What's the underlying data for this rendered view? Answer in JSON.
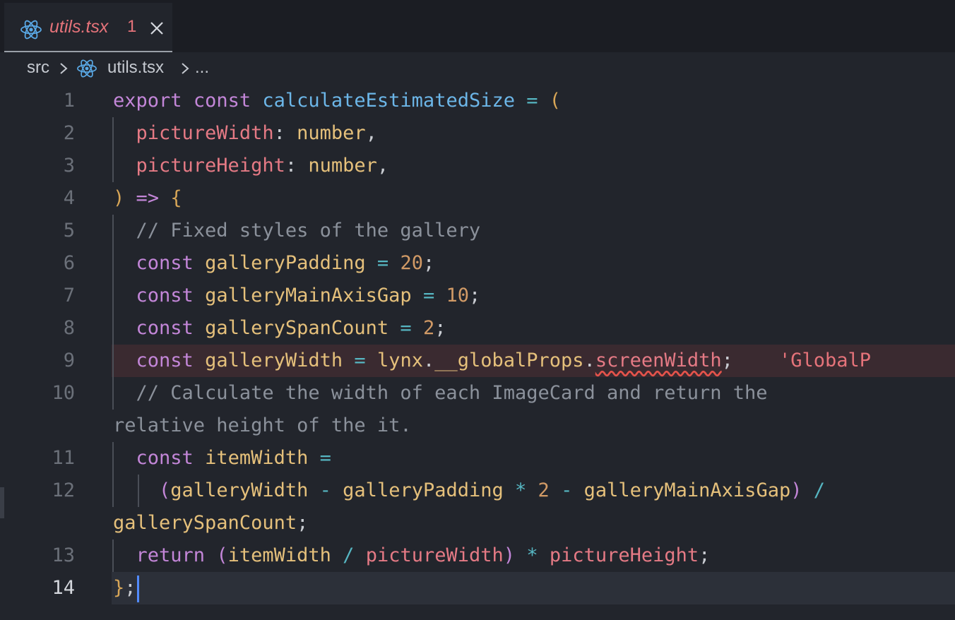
{
  "tab": {
    "title": "utils.tsx",
    "problem_count": "1",
    "icon": "react-icon",
    "close_icon": "close-icon"
  },
  "breadcrumb": {
    "folder": "src",
    "file": "utils.tsx",
    "more": "..."
  },
  "lines": {
    "n1": "1",
    "n2": "2",
    "n3": "3",
    "n4": "4",
    "n5": "5",
    "n6": "6",
    "n7": "7",
    "n8": "8",
    "n9": "9",
    "n10": "10",
    "n11": "11",
    "n12": "12",
    "n13": "13",
    "n14": "14"
  },
  "code": {
    "l1_export": "export",
    "l1_const": "const",
    "l1_fn": "calculateEstimatedSize",
    "l1_eq": "=",
    "l1_paren": "(",
    "l2_param": "pictureWidth",
    "l2_colon": ":",
    "l2_type": "number",
    "l2_comma": ",",
    "l3_param": "pictureHeight",
    "l3_colon": ":",
    "l3_type": "number",
    "l3_comma": ",",
    "l4_paren": ")",
    "l4_arrow": "=>",
    "l4_brace": "{",
    "l5_comment": "// Fixed styles of the gallery",
    "l6_const": "const",
    "l6_var": "galleryPadding",
    "l6_eq": "=",
    "l6_num": "20",
    "l6_semi": ";",
    "l7_const": "const",
    "l7_var": "galleryMainAxisGap",
    "l7_eq": "=",
    "l7_num": "10",
    "l7_semi": ";",
    "l8_const": "const",
    "l8_var": "gallerySpanCount",
    "l8_eq": "=",
    "l8_num": "2",
    "l8_semi": ";",
    "l9_const": "const",
    "l9_var": "galleryWidth",
    "l9_eq": "=",
    "l9_obj": "lynx",
    "l9_dot1": ".",
    "l9_prop1": "__globalProps",
    "l9_dot2": ".",
    "l9_prop2": "screenWidth",
    "l9_semi": ";",
    "l9_error": "'GlobalP",
    "l10_comment": "// Calculate the width of each ImageCard and return the",
    "l10_cont": "relative height of the it.",
    "l11_const": "const",
    "l11_var": "itemWidth",
    "l11_eq": "=",
    "l12_open": "(",
    "l12_a": "galleryWidth",
    "l12_minus1": "-",
    "l12_b": "galleryPadding",
    "l12_mul": "*",
    "l12_two": "2",
    "l12_minus2": "-",
    "l12_c": "galleryMainAxisGap",
    "l12_close": ")",
    "l12_div": "/",
    "l12_cont_var": "gallerySpanCount",
    "l12_cont_semi": ";",
    "l13_return": "return",
    "l13_open": "(",
    "l13_a": "itemWidth",
    "l13_div": "/",
    "l13_b": "pictureWidth",
    "l13_close": ")",
    "l13_mul": "*",
    "l13_c": "pictureHeight",
    "l13_semi": ";",
    "l14_brace": "}",
    "l14_semi": ";"
  },
  "colors": {
    "background": "#22252c",
    "keyword": "#c386d8",
    "function": "#6cb6e8",
    "variable": "#e5c07b",
    "parameter": "#e57a85",
    "operator": "#56b6c2",
    "number": "#d19a66",
    "comment": "#8b919b",
    "error": "#e5534b"
  }
}
